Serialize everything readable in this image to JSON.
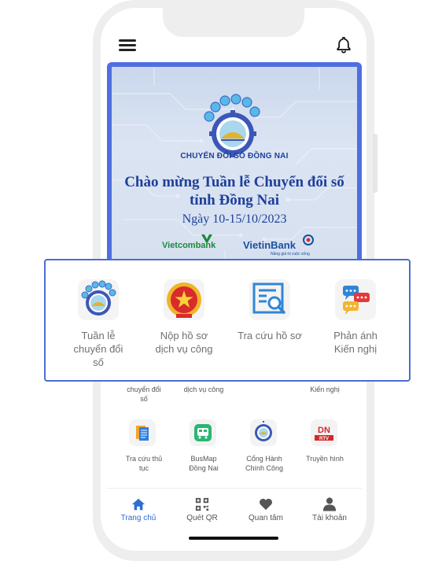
{
  "banner": {
    "org": "CHUYỂN ĐỔI SỐ ĐỒNG NAI",
    "title_line1": "Chào mừng Tuần lễ Chuyển đổi số",
    "title_line2": "tỉnh Đồng Nai",
    "date": "Ngày 10-15/10/2023",
    "sponsor1": "Vietcombank",
    "sponsor2": "VietinBank",
    "sponsor2_tagline": "Nâng giá trị cuộc sống"
  },
  "overlay": {
    "items": [
      {
        "line1": "Tuần lễ",
        "line2": "chuyển đổi",
        "line3": "số"
      },
      {
        "line1": "Nộp hồ sơ",
        "line2": "dịch vụ công"
      },
      {
        "line1": "Tra cứu hồ sơ"
      },
      {
        "line1": "Phản ánh",
        "line2": "Kiến nghị"
      }
    ]
  },
  "grid": {
    "row1": [
      {
        "line1": "chuyển đổi",
        "line2": "số"
      },
      {
        "line1": "dịch vụ công"
      },
      {
        "line1": "Kiến nghị"
      }
    ],
    "row2": [
      {
        "line1": "Tra cứu thủ",
        "line2": "tục",
        "icon": "document-icon"
      },
      {
        "line1": "BusMap",
        "line2": "Đồng Nai",
        "icon": "bus-icon"
      },
      {
        "line1": "Cổng Hành",
        "line2": "Chính Công",
        "icon": "gear-logo-icon"
      },
      {
        "line1": "Truyền hình",
        "icon": "tv-logo-icon"
      }
    ]
  },
  "nav": {
    "items": [
      {
        "label": "Trang chủ",
        "icon": "home-icon",
        "active": true
      },
      {
        "label": "Quét QR",
        "icon": "qr-icon"
      },
      {
        "label": "Quan tâm",
        "icon": "heart-icon"
      },
      {
        "label": "Tài khoản",
        "icon": "user-icon"
      }
    ]
  },
  "colors": {
    "accent": "#2f6fd0",
    "overlay_border": "#4a6ed0",
    "banner_title": "#1e3f9a"
  },
  "tv_logo_text": "DN RTV"
}
